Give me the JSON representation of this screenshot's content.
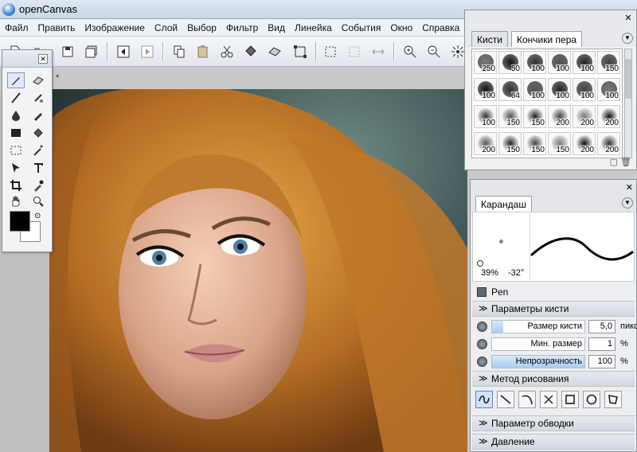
{
  "window": {
    "title": "openCanvas"
  },
  "menu": [
    "Файл",
    "Править",
    "Изображение",
    "Слой",
    "Выбор",
    "Фильтр",
    "Вид",
    "Линейка",
    "События",
    "Окно",
    "Справка"
  ],
  "toolbar": {
    "icons": [
      "new-file-icon",
      "open-file-icon",
      "save-icon",
      "save-all-icon",
      "prev-page-icon",
      "next-page-icon",
      "copy-icon",
      "paste-icon",
      "cut-icon",
      "fill-icon",
      "eraser-icon",
      "transform-icon",
      "select-rect-icon",
      "deselect-icon",
      "flip-icon",
      "zoom-in-icon",
      "zoom-out-icon",
      "rotate-icon"
    ]
  },
  "canvas": {
    "tab_marker": "*"
  },
  "tools": {
    "icons": [
      "pencil-icon",
      "eraser-tool-icon",
      "brush-icon",
      "airbrush-icon",
      "water-icon",
      "marker-icon",
      "fill-rect-icon",
      "bucket-icon",
      "rect-select-icon",
      "magic-wand-icon",
      "move-icon",
      "text-icon",
      "crop-icon",
      "eyedropper-icon",
      "hand-icon",
      "zoom-icon"
    ],
    "colors": {
      "foreground": "#000000",
      "background": "#ffffff"
    }
  },
  "brush_panel": {
    "tabs": [
      "Кисти",
      "Кончики пера"
    ],
    "rows": [
      [
        "250",
        "50",
        "100",
        "100",
        "100",
        "150"
      ],
      [
        "100",
        "64",
        "100",
        "100",
        "100",
        "100"
      ],
      [
        "100",
        "150",
        "150",
        "200",
        "200",
        "200"
      ],
      [
        "200",
        "150",
        "150",
        "150",
        "200",
        "200"
      ]
    ]
  },
  "pencil_panel": {
    "tab": "Карандаш",
    "preview": {
      "percent": "39%",
      "angle": "-32°"
    },
    "pen_label": "Pen",
    "sections": {
      "brush_params": "Параметры кисти",
      "draw_method": "Метод рисования",
      "stroke_param": "Параметр обводки",
      "pressure": "Давление"
    },
    "params": [
      {
        "label": "Размер кисти",
        "value": "5,0",
        "unit": "пикс",
        "fill": 0.12
      },
      {
        "label": "Мин. размер",
        "value": "1",
        "unit": "%",
        "fill": 0.0
      },
      {
        "label": "Непрозрачность",
        "value": "100",
        "unit": "%",
        "fill": 1.0
      }
    ],
    "methods": [
      "freehand-icon",
      "line-icon",
      "curve-icon",
      "polyline-icon",
      "rectangle-icon",
      "ellipse-icon",
      "polygon-icon"
    ]
  }
}
